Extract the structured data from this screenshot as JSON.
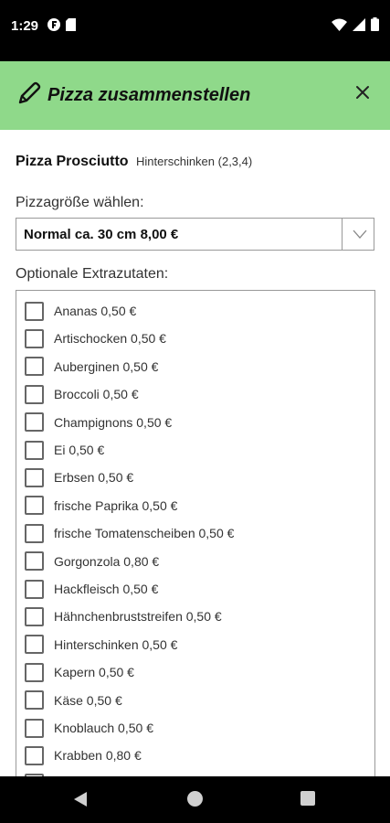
{
  "status_bar": {
    "time": "1:29",
    "left_icons": [
      "app-notification-icon",
      "sd-card-icon"
    ],
    "right_icons": [
      "wifi-icon",
      "cell-signal-icon",
      "battery-icon"
    ]
  },
  "dialog": {
    "title": "Pizza zusammenstellen",
    "header_color": "#8fd98a"
  },
  "pizza": {
    "name": "Pizza Prosciutto",
    "description": "Hinterschinken (2,3,4)"
  },
  "size": {
    "label": "Pizzagröße wählen:",
    "selected": "Normal ca. 30 cm 8,00 €"
  },
  "extras": {
    "label": "Optionale Extrazutaten:",
    "items": [
      {
        "label": "Ananas 0,50 €",
        "checked": false
      },
      {
        "label": "Artischocken 0,50 €",
        "checked": false
      },
      {
        "label": "Auberginen 0,50 €",
        "checked": false
      },
      {
        "label": "Broccoli 0,50 €",
        "checked": false
      },
      {
        "label": "Champignons 0,50 €",
        "checked": false
      },
      {
        "label": "Ei 0,50 €",
        "checked": false
      },
      {
        "label": "Erbsen 0,50 €",
        "checked": false
      },
      {
        "label": "frische Paprika 0,50 €",
        "checked": false
      },
      {
        "label": "frische Tomatenscheiben 0,50 €",
        "checked": false
      },
      {
        "label": "Gorgonzola 0,80 €",
        "checked": false
      },
      {
        "label": "Hackfleisch 0,50 €",
        "checked": false
      },
      {
        "label": "Hähnchenbruststreifen 0,50 €",
        "checked": false
      },
      {
        "label": "Hinterschinken 0,50 €",
        "checked": false
      },
      {
        "label": "Kapern 0,50 €",
        "checked": false
      },
      {
        "label": "Käse 0,50 €",
        "checked": false
      },
      {
        "label": "Knoblauch 0,50 €",
        "checked": false
      },
      {
        "label": "Krabben 0,80 €",
        "checked": false
      }
    ]
  },
  "nav_bar": {
    "buttons": [
      "back-icon",
      "home-icon",
      "recents-icon"
    ]
  }
}
